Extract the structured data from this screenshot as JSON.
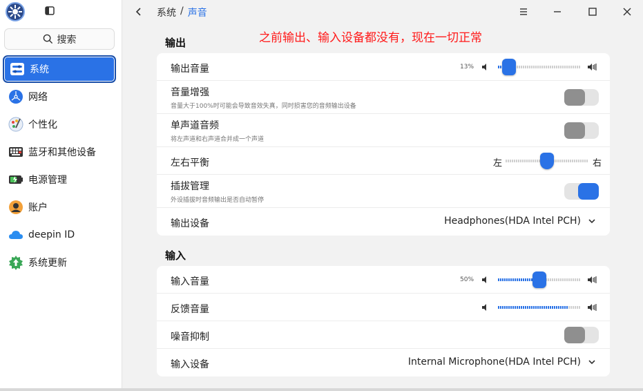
{
  "window": {
    "breadcrumb_parent": "系统",
    "breadcrumb_sep": "/",
    "breadcrumb_current": "声音"
  },
  "search": {
    "label": "搜索"
  },
  "sidebar": {
    "items": [
      {
        "label": "系统",
        "icon": "system-icon",
        "active": true
      },
      {
        "label": "网络",
        "icon": "network-icon"
      },
      {
        "label": "个性化",
        "icon": "personalization-icon"
      },
      {
        "label": "蓝牙和其他设备",
        "icon": "bluetooth-devices-icon"
      },
      {
        "label": "电源管理",
        "icon": "power-icon"
      },
      {
        "label": "账户",
        "icon": "account-icon"
      },
      {
        "label": "deepin ID",
        "icon": "cloud-icon"
      },
      {
        "label": "系统更新",
        "icon": "update-icon"
      }
    ]
  },
  "annotation": "之前输出、输入设备都没有，现在一切正常",
  "output": {
    "title": "输出",
    "volume": {
      "label": "输出音量",
      "percent": "13%",
      "value": 13
    },
    "boost": {
      "label": "音量增强",
      "desc": "音量大于100%时可能会导致音效失真，同时损害您的音频输出设备",
      "on": false
    },
    "mono": {
      "label": "单声道音频",
      "desc": "将左声道和右声道合并成一个声道",
      "on": false
    },
    "balance": {
      "label": "左右平衡",
      "left": "左",
      "right": "右",
      "value": 50
    },
    "plug": {
      "label": "插拔管理",
      "desc": "外设插拔时音频输出是否自动暂停",
      "on": true
    },
    "device": {
      "label": "输出设备",
      "value": "Headphones(HDA Intel PCH)"
    }
  },
  "input": {
    "title": "输入",
    "volume": {
      "label": "输入音量",
      "percent": "50%",
      "value": 50
    },
    "feedback": {
      "label": "反馈音量",
      "value": 85
    },
    "noise": {
      "label": "噪音抑制",
      "on": false
    },
    "device": {
      "label": "输入设备",
      "value": "Internal Microphone(HDA Intel PCH)"
    }
  },
  "colors": {
    "accent": "#2a72e6",
    "annotation": "#ff1a1a"
  }
}
